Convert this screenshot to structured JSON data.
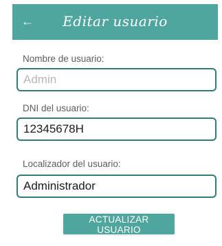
{
  "app_bar": {
    "title": "Editar usuario",
    "back_icon": "arrow-left-icon",
    "back_glyph": "←",
    "color": "#4fa69f"
  },
  "form": {
    "username": {
      "label": "Nombre de usuario:",
      "value": "",
      "placeholder": "Admin"
    },
    "dni": {
      "label": "DNI del usuario:",
      "value": "12345678H",
      "placeholder": ""
    },
    "locator": {
      "label": "Localizador del usuario:",
      "value": "Administrador",
      "placeholder": ""
    }
  },
  "actions": {
    "update_label": "ACTUALIZAR USUARIO",
    "button_color": "#4fa69f"
  },
  "colors": {
    "field_border": "#2f7e74",
    "label_text": "#5d5d5d"
  }
}
